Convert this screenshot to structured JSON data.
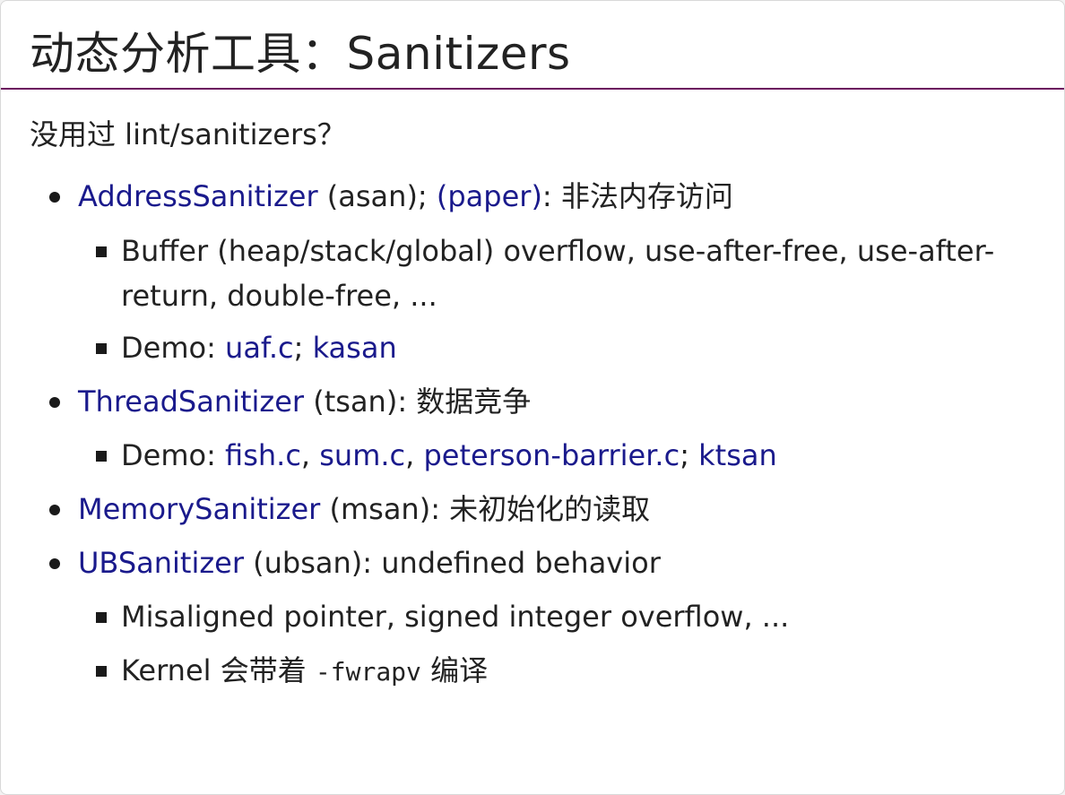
{
  "title": "动态分析工具：Sanitizers",
  "intro": "没用过 lint/sanitizers？",
  "items": [
    {
      "link": "AddressSanitizer",
      "text_a": " (asan); ",
      "link2": "(paper)",
      "text_b": ": 非法内存访问",
      "sub": [
        {
          "text": "Buffer (heap/stack/global) overflow, use-after-free, use-after-return, double-free, ..."
        },
        {
          "prefix": "Demo: ",
          "link_a": "uaf.c",
          "sep": "; ",
          "link_b": "kasan"
        }
      ]
    },
    {
      "link": "ThreadSanitizer",
      "text_a": " (tsan): 数据竞争",
      "sub": [
        {
          "prefix": "Demo: ",
          "link_a": "fish.c",
          "sep_a": ", ",
          "link_b": "sum.c",
          "sep_b": ", ",
          "link_c": "peterson-barrier.c",
          "sep_c": "; ",
          "link_d": "ktsan"
        }
      ]
    },
    {
      "link": "MemorySanitizer",
      "text_a": " (msan): 未初始化的读取"
    },
    {
      "link": "UBSanitizer",
      "text_a": " (ubsan): undefined behavior",
      "sub": [
        {
          "text": "Misaligned pointer, signed integer overflow, ..."
        },
        {
          "prefix": "Kernel 会带着 ",
          "code": "-fwrapv",
          "suffix": " 编译"
        }
      ]
    }
  ]
}
